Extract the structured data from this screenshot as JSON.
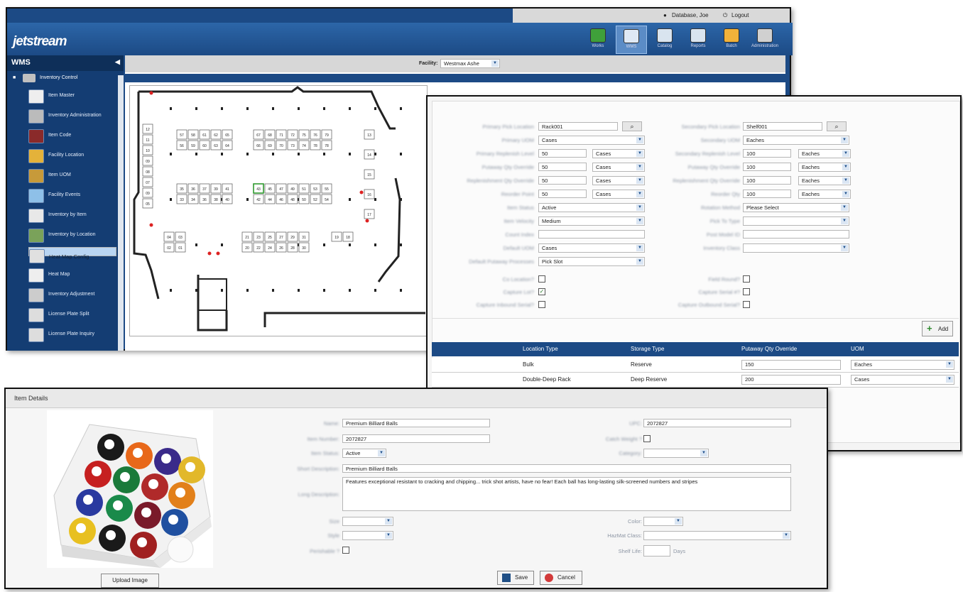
{
  "app": {
    "brand": "jetstream",
    "user_label": "Database, Joe",
    "logout_label": "Logout",
    "nav": [
      {
        "label": "Works",
        "color": "#3fa03a"
      },
      {
        "label": "WMS",
        "color": "#dfe9f5"
      },
      {
        "label": "Catalog",
        "color": "#d9e4ef"
      },
      {
        "label": "Reports",
        "color": "#d9e4ef"
      },
      {
        "label": "Batch",
        "color": "#f2b23a"
      },
      {
        "label": "Administration",
        "color": "#d0d0d0"
      }
    ]
  },
  "sidebar": {
    "title": "WMS",
    "root": "Inventory Control",
    "items": [
      {
        "label": "Item Master",
        "color": "#eeeeee"
      },
      {
        "label": "Inventory Administration",
        "color": "#bbbbbb"
      },
      {
        "label": "Item Code",
        "color": "#8a2a2a"
      },
      {
        "label": "Facility Location",
        "color": "#e4b23a"
      },
      {
        "label": "Item UOM",
        "color": "#c79a3a"
      },
      {
        "label": "Facility Events",
        "color": "#8ec0e8"
      },
      {
        "label": "Inventory by Item",
        "color": "#e8e8e8"
      },
      {
        "label": "Inventory by Location",
        "color": "#7aa25a"
      },
      {
        "label": "Heat Map Config",
        "color": "#e0e0e0"
      },
      {
        "label": "Heat Map",
        "color": "#eeeeee"
      },
      {
        "label": "Inventory Adjustment",
        "color": "#cccccc"
      },
      {
        "label": "License Plate Split",
        "color": "#dddddd"
      },
      {
        "label": "License Plate Inquiry",
        "color": "#dddddd"
      }
    ],
    "selected_index": 8
  },
  "facility": {
    "label": "Facility:",
    "value": "Westmax Ashe"
  },
  "floorplan": {
    "top_rows": [
      [
        "57",
        "58",
        "61",
        "62",
        "65"
      ],
      [
        "56",
        "59",
        "60",
        "63",
        "64"
      ],
      [
        "67",
        "68",
        "71",
        "72",
        "75",
        "76",
        "79"
      ],
      [
        "66",
        "69",
        "70",
        "73",
        "74",
        "78",
        "78"
      ]
    ],
    "mid_rows": [
      [
        "35",
        "36",
        "37",
        "39",
        "41"
      ],
      [
        "33",
        "34",
        "36",
        "38",
        "40"
      ],
      [
        "43",
        "45",
        "47",
        "49",
        "51",
        "53",
        "55"
      ],
      [
        "42",
        "44",
        "46",
        "48",
        "50",
        "52",
        "54"
      ]
    ],
    "left_col": [
      "12",
      "11",
      "10",
      "09",
      "08",
      "07",
      "09",
      "05"
    ],
    "right_col": [
      "13",
      "14",
      "15",
      "16",
      "17"
    ],
    "bottom_left": [
      [
        "04",
        "03"
      ],
      [
        "02",
        "01"
      ]
    ],
    "bottom_mid": [
      [
        "21",
        "23",
        "25",
        "27",
        "29",
        "31"
      ],
      [
        "20",
        "22",
        "24",
        "26",
        "28",
        "30"
      ]
    ],
    "bottom_right": [
      [
        "19",
        "18"
      ]
    ],
    "selected_cell": "43"
  },
  "location_form": {
    "left": [
      {
        "label": "Primary Pick Location",
        "type": "lookup",
        "value": "Rack001"
      },
      {
        "label": "Primary UOM",
        "type": "select",
        "value": "Cases"
      },
      {
        "label": "Primary Replenish Level",
        "type": "qty",
        "value": "50",
        "unit": "Cases"
      },
      {
        "label": "Putaway Qty Override",
        "type": "qty",
        "value": "50",
        "unit": "Cases"
      },
      {
        "label": "Replenishment Qty Override",
        "type": "qty",
        "value": "50",
        "unit": "Cases"
      },
      {
        "label": "Reorder Point",
        "type": "qty",
        "value": "50",
        "unit": "Cases"
      },
      {
        "label": "Item Status",
        "type": "select",
        "value": "Active"
      },
      {
        "label": "Item Velocity",
        "type": "select",
        "value": "Medium"
      },
      {
        "label": "Count Index",
        "type": "text",
        "value": ""
      },
      {
        "label": "Default UOM",
        "type": "select",
        "value": "Cases"
      },
      {
        "label": "Default Putaway Processes",
        "type": "select",
        "value": "Pick Slot"
      }
    ],
    "right": [
      {
        "label": "Secondary Pick Location",
        "type": "lookup",
        "value": "Shelf001"
      },
      {
        "label": "Secondary UOM",
        "type": "select",
        "value": "Eaches"
      },
      {
        "label": "Secondary Replenish Level",
        "type": "qty",
        "value": "100",
        "unit": "Eaches"
      },
      {
        "label": "Putaway Qty Override",
        "type": "qty",
        "value": "100",
        "unit": "Eaches"
      },
      {
        "label": "Replenishment Qty Override",
        "type": "qty",
        "value": "100",
        "unit": "Eaches"
      },
      {
        "label": "Reorder Qty",
        "type": "qty",
        "value": "100",
        "unit": "Eaches"
      },
      {
        "label": "Rotation Method",
        "type": "select",
        "value": "Please Select"
      },
      {
        "label": "Pick To Type",
        "type": "select",
        "value": ""
      },
      {
        "label": "Post Model ID",
        "type": "text",
        "value": ""
      },
      {
        "label": "Inventory Class",
        "type": "select",
        "value": ""
      }
    ],
    "checks_left": [
      {
        "label": "Co Location?",
        "checked": false
      },
      {
        "label": "Capture Lot?",
        "checked": true
      },
      {
        "label": "Capture Inbound Serial?",
        "checked": false
      }
    ],
    "checks_right": [
      {
        "label": "Field Round?",
        "checked": false
      },
      {
        "label": "Capture Serial #?",
        "checked": false
      },
      {
        "label": "Capture Outbound Serial?",
        "checked": false
      }
    ],
    "add_label": "Add",
    "grid_headers": [
      "Location Type",
      "Storage Type",
      "Putaway Qty Override",
      "UOM"
    ],
    "grid_rows": [
      {
        "location_type": "Bulk",
        "storage_type": "Reserve",
        "qty": "150",
        "uom": "Eaches"
      },
      {
        "location_type": "Double-Deep Rack",
        "storage_type": "Deep Reserve",
        "qty": "200",
        "uom": "Cases"
      }
    ]
  },
  "item": {
    "title": "Item Details",
    "name_label": "Name:",
    "name": "Premium Billiard Balls",
    "upc_label": "UPC:",
    "upc": "2072827",
    "item_number_label": "Item Number:",
    "item_number": "2072827",
    "catch_weight_label": "Catch Weight ?",
    "status_label": "Item Status:",
    "status": "Active",
    "category_label": "Category:",
    "category": "",
    "short_desc_label": "Short Description:",
    "short_desc": "Premium Billiard Balls",
    "long_desc_label": "Long Description:",
    "long_desc": "Features exceptional resistant to cracking and chipping... trick shot artists, have no fear! Each ball has long-lasting silk-screened numbers and stripes",
    "size_label": "Size",
    "style_label": "Style",
    "perishable_label": "Perishable ?",
    "color_label": "Color:",
    "hazmat_label": "HazMat Class:",
    "shelf_life_label": "Shelf Life:",
    "days_label": "Days",
    "upload_label": "Upload Image",
    "save_label": "Save",
    "cancel_label": "Cancel"
  }
}
